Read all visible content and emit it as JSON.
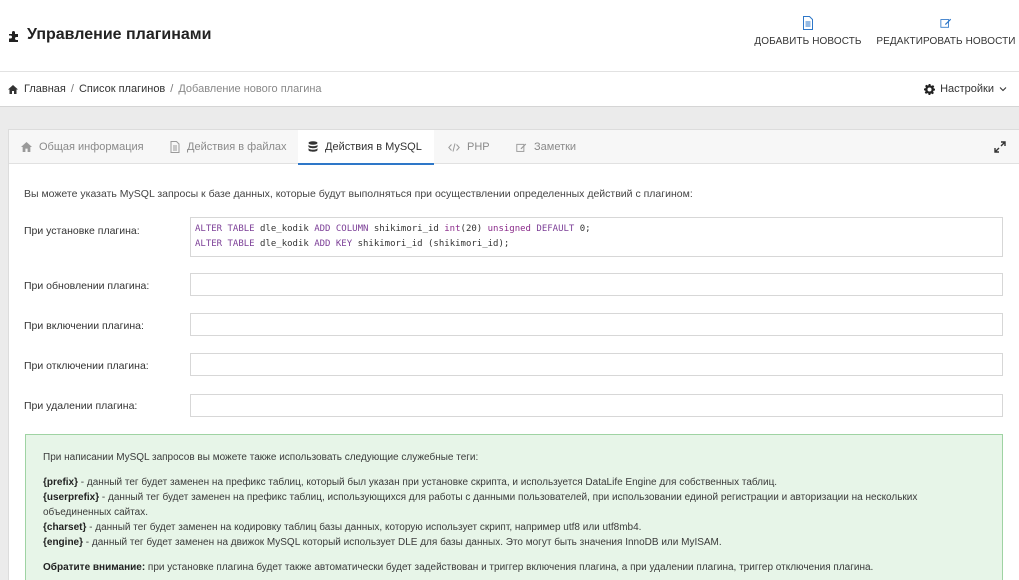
{
  "header": {
    "title": "Управление плагинами",
    "title_icon": "puzzle-icon",
    "actions": [
      {
        "label": "ДОБАВИТЬ НОВОСТЬ",
        "icon": "document-icon"
      },
      {
        "label": "РЕДАКТИРОВАТЬ НОВОСТИ",
        "icon": "edit-icon"
      }
    ],
    "accent_color": "#2e77c8"
  },
  "breadcrumb": {
    "home": "Главная",
    "sep": "/",
    "list": "Список плагинов",
    "current": "Добавление нового плагина"
  },
  "settings_label": "Настройки",
  "tabs": [
    {
      "label": "Общая информация",
      "icon": "home-icon",
      "active": false
    },
    {
      "label": "Действия в файлах",
      "icon": "file-icon",
      "active": false
    },
    {
      "label": "Действия в MySQL",
      "icon": "database-icon",
      "active": true
    },
    {
      "label": "PHP",
      "icon": "code-icon",
      "active": false
    },
    {
      "label": "Заметки",
      "icon": "edit-icon",
      "active": false
    }
  ],
  "intro": "Вы можете указать MySQL запросы к базе данных, которые будут выполняться при осуществлении определенных действий с плагином:",
  "fields": {
    "install": {
      "label": "При установке плагина:",
      "line1": {
        "a": "ALTER TABLE",
        "b": " dle_kodik ",
        "c": "ADD COLUMN",
        "d": " shikimori_id ",
        "e": "int",
        "f": "(20) ",
        "g": "unsigned",
        "h": " ",
        "i": "DEFAULT",
        "j": " 0;"
      },
      "line2": {
        "a": "ALTER TABLE",
        "b": " dle_kodik ",
        "c": "ADD KEY",
        "d": " shikimori_id (shikimori_id);"
      }
    },
    "update": {
      "label": "При обновлении плагина:",
      "value": ""
    },
    "enable": {
      "label": "При включении плагина:",
      "value": ""
    },
    "disable": {
      "label": "При отключении плагина:",
      "value": ""
    },
    "delete": {
      "label": "При удалении плагина:",
      "value": ""
    }
  },
  "note": {
    "intro": "При написании MySQL запросов вы можете также использовать следующие служебные теги:",
    "prefix_tag": "{prefix}",
    "prefix_text": " - данный тег будет заменен на префикс таблиц, который был указан при установке скрипта, и используется DataLife Engine для собственных таблиц.",
    "userprefix_tag": "{userprefix}",
    "userprefix_text": " - данный тег будет заменен на префикс таблиц, использующихся для работы с данными пользователей, при использовании единой регистрации и авторизации на нескольких объединенных сайтах.",
    "charset_tag": "{charset}",
    "charset_text": " - данный тег будет заменен на кодировку таблиц базы данных, которую использует скрипт, например utf8 или utf8mb4.",
    "engine_tag": "{engine}",
    "engine_text": " - данный тег будет заменен на движок MySQL который использует DLE для базы данных. Это могут быть значения InnoDB или MyISAM.",
    "attention_label": "Обратите внимание:",
    "attention_text": " при установке плагина будет также автоматически будет задействован и триггер включения плагина, а при удалении плагина, триггер отключения плагина."
  }
}
